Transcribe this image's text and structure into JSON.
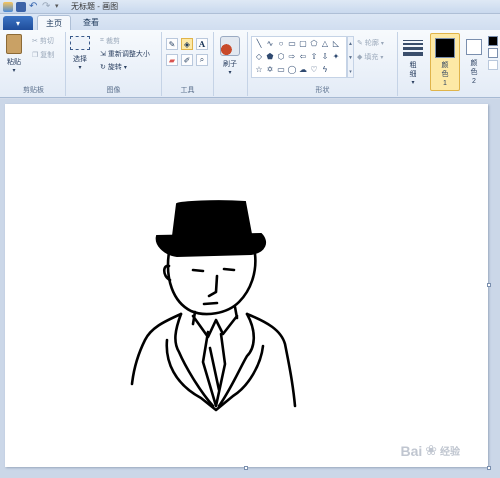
{
  "window": {
    "title": "无标题 - 画图"
  },
  "file_button": {
    "label": "▾"
  },
  "tabs": [
    {
      "label": "主页"
    },
    {
      "label": "查看"
    }
  ],
  "groups": {
    "clipboard": {
      "label": "剪贴板",
      "paste": "粘贴",
      "cut": "剪切",
      "copy": "复制"
    },
    "image": {
      "label": "图像",
      "select": "选择",
      "crop": "裁剪",
      "resize": "重新调整大小",
      "rotate": "旋转"
    },
    "tools": {
      "label": "工具",
      "text_glyph": "A"
    },
    "brushes": {
      "label": "刷子"
    },
    "shapes": {
      "label": "形状",
      "outline": "轮廓",
      "fill": "填充"
    },
    "size": {
      "label": "粗细"
    },
    "color1": {
      "label": "颜色 1",
      "value": "#000000"
    },
    "color2": {
      "label": "颜色 2",
      "value": "#ffffff"
    }
  },
  "watermark": {
    "text": "Bai",
    "suffix": "经验"
  }
}
